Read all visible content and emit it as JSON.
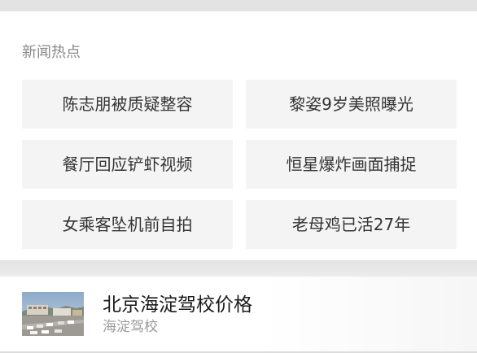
{
  "hot_news": {
    "title": "新闻热点",
    "items": [
      {
        "label": "陈志朋被质疑整容"
      },
      {
        "label": "黎姿9岁美照曝光"
      },
      {
        "label": "餐厅回应铲虾视频"
      },
      {
        "label": "恒星爆炸画面捕捉"
      },
      {
        "label": "女乘客坠机前自拍"
      },
      {
        "label": "老母鸡已活27年"
      }
    ]
  },
  "ad": {
    "title": "北京海淀驾校价格",
    "subtitle": "海淀驾校",
    "thumbnail_icon": "driving-school-photo"
  },
  "colors": {
    "card_background": "#ffffff",
    "page_background": "#e6e6e6",
    "tile_background": "#f4f4f4",
    "tile_text": "#333333",
    "section_title": "#8a8a8a",
    "ad_subtitle": "#9a9a9a"
  }
}
